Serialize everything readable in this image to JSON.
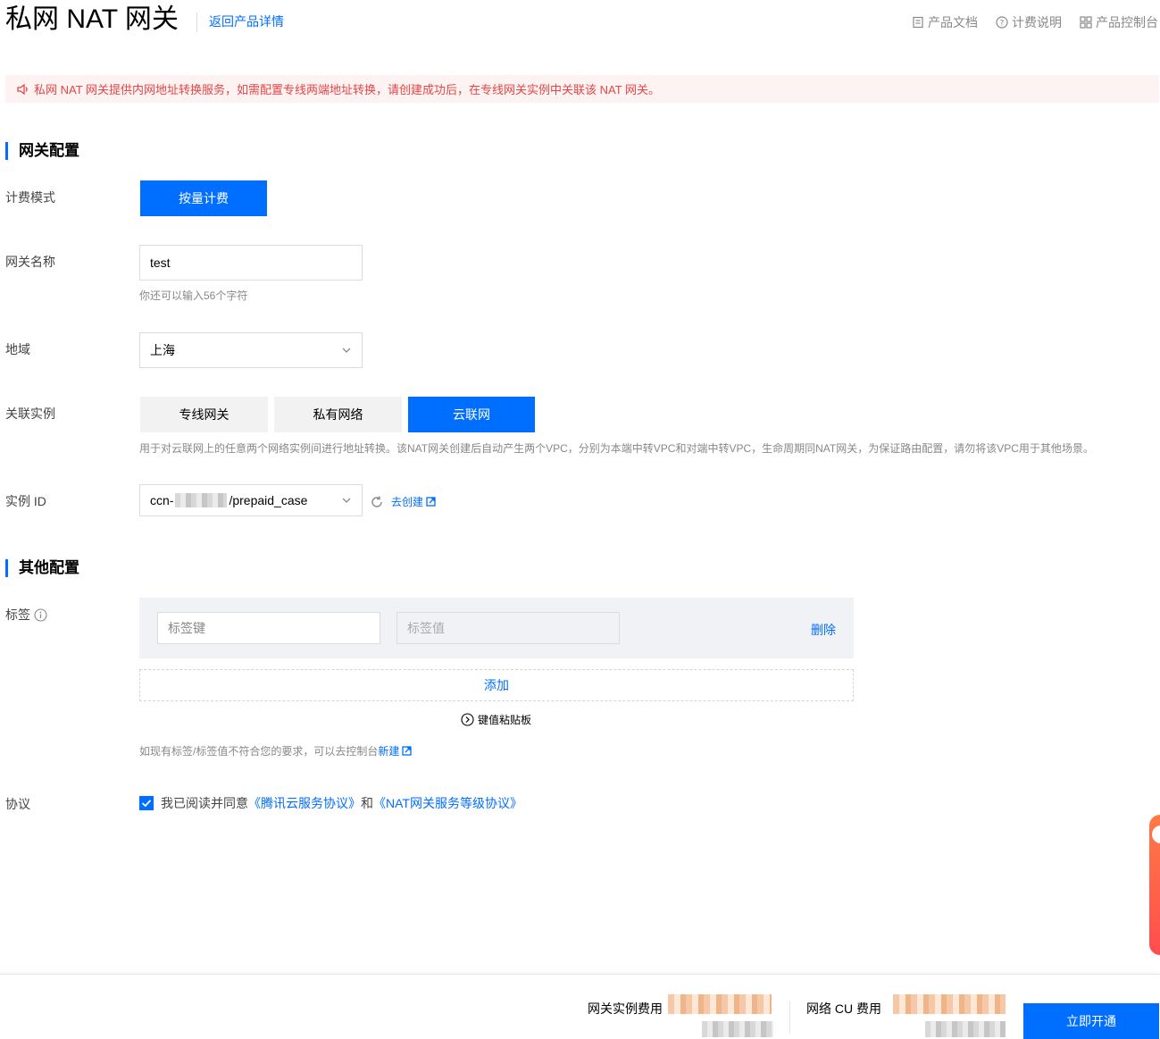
{
  "header": {
    "title": "私网 NAT 网关",
    "back_link": "返回产品详情",
    "links": [
      "产品文档",
      "计费说明",
      "产品控制台"
    ]
  },
  "alert": {
    "text": "私网 NAT 网关提供内网地址转换服务，如需配置专线两端地址转换，请创建成功后，在专线网关实例中关联该 NAT 网关。"
  },
  "gateway_config": {
    "section_title": "网关配置",
    "billing": {
      "label": "计费模式",
      "option": "按量计费"
    },
    "name": {
      "label": "网关名称",
      "value": "test",
      "hint": "你还可以输入56个字符"
    },
    "region": {
      "label": "地域",
      "value": "上海"
    },
    "instance_type": {
      "label": "关联实例",
      "options": [
        "专线网关",
        "私有网络",
        "云联网"
      ],
      "selected": "云联网",
      "hint": "用于对云联网上的任意两个网络实例间进行地址转换。该NAT网关创建后自动产生两个VPC，分别为本端中转VPC和对端中转VPC，生命周期同NAT网关，为保证路由配置，请勿将该VPC用于其他场景。"
    },
    "instance_id": {
      "label": "实例 ID",
      "prefix": "ccn-",
      "suffix": "/prepaid_case",
      "create_link": "去创建"
    }
  },
  "other_config": {
    "section_title": "其他配置",
    "tags": {
      "label": "标签",
      "key_placeholder": "标签键",
      "value_placeholder": "标签值",
      "delete": "删除",
      "add": "添加",
      "clipboard": "键值粘贴板",
      "hint": "如现有标签/标签值不符合您的要求，可以去控制台",
      "hint_link": "新建"
    },
    "agreement": {
      "label": "协议",
      "checked": true,
      "text": "我已阅读并同意",
      "link1": "《腾讯云服务协议》",
      "and": "和",
      "link2": "《NAT网关服务等级协议》"
    }
  },
  "footer": {
    "fee1_label": "网关实例费用",
    "fee2_label": "网络 CU 费用",
    "submit": "立即开通"
  },
  "colors": {
    "primary": "#006eff",
    "alert_text": "#e54545",
    "alert_bg": "#fdf3f3"
  }
}
